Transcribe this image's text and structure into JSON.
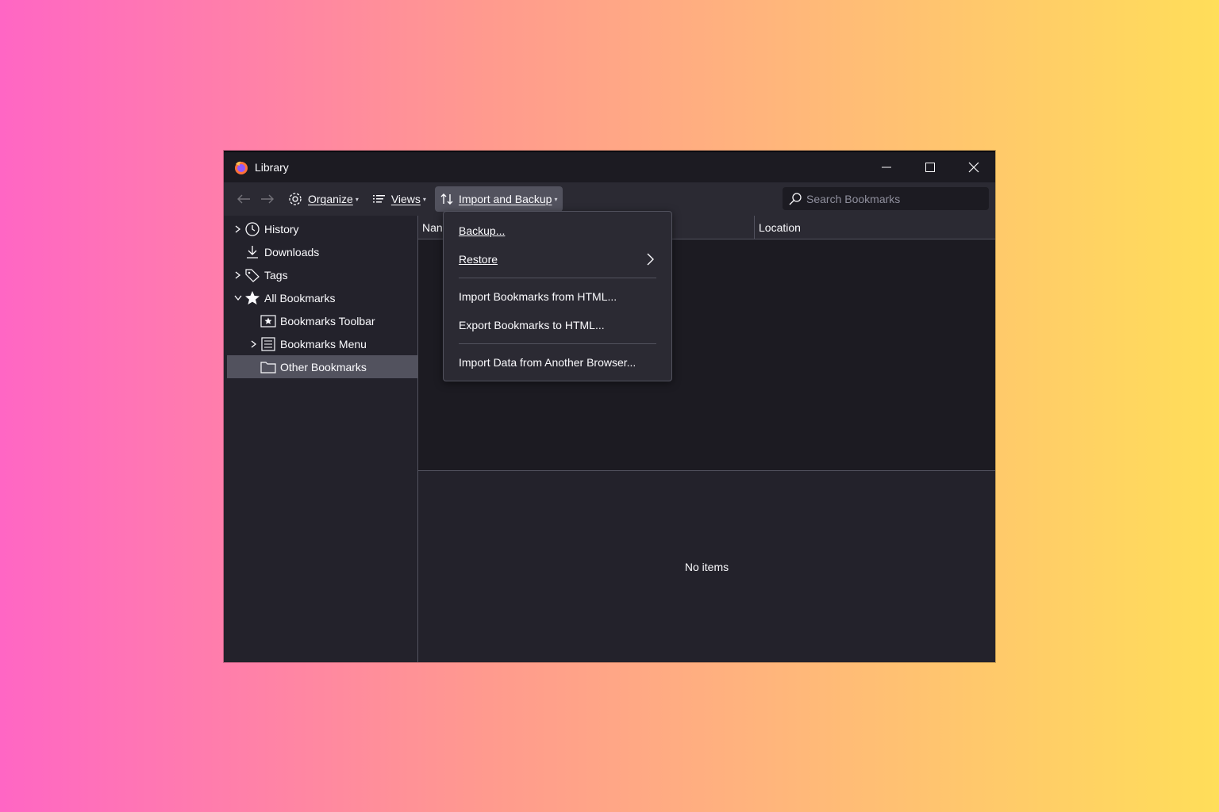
{
  "window": {
    "title": "Library"
  },
  "toolbar": {
    "organize": "Organize",
    "views": "Views",
    "import_backup": "Import and Backup",
    "search_placeholder": "Search Bookmarks"
  },
  "sidebar": {
    "items": [
      {
        "label": "History"
      },
      {
        "label": "Downloads"
      },
      {
        "label": "Tags"
      },
      {
        "label": "All Bookmarks"
      },
      {
        "label": "Bookmarks Toolbar"
      },
      {
        "label": "Bookmarks Menu"
      },
      {
        "label": "Other Bookmarks"
      }
    ]
  },
  "columns": {
    "name": "Nan",
    "location": "Location"
  },
  "detail": {
    "empty_text": "No items"
  },
  "menu": {
    "items": [
      {
        "label": "Backup..."
      },
      {
        "label": "Restore"
      },
      {
        "label": "Import Bookmarks from HTML..."
      },
      {
        "label": "Export Bookmarks to HTML..."
      },
      {
        "label": "Import Data from Another Browser..."
      }
    ]
  }
}
